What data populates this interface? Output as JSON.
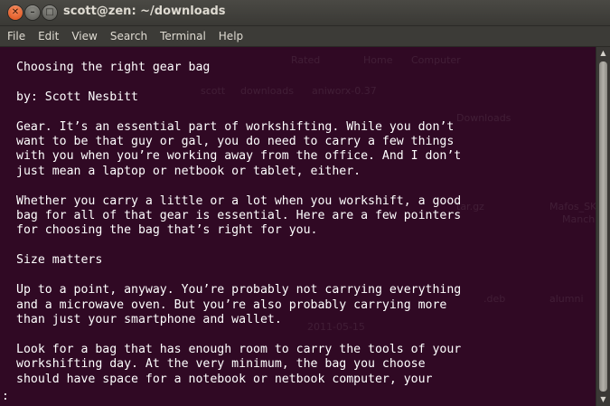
{
  "window": {
    "title": "scott@zen: ~/downloads",
    "controls": {
      "close_glyph": "✕",
      "minimize_glyph": "–",
      "maximize_glyph": "□"
    }
  },
  "menubar": {
    "items": [
      "File",
      "Edit",
      "View",
      "Search",
      "Terminal",
      "Help"
    ]
  },
  "terminal": {
    "lines": [
      "Choosing the right gear bag",
      "",
      "by: Scott Nesbitt",
      "",
      "Gear. It’s an essential part of workshifting. While you don’t",
      "want to be that guy or gal, you do need to carry a few things",
      "with you when you’re working away from the office. And I don’t",
      "just mean a laptop or netbook or tablet, either.",
      "",
      "Whether you carry a little or a lot when you workshift, a good",
      "bag for all of that gear is essential. Here are a few pointers",
      "for choosing the bag that’s right for you.",
      "",
      "Size matters",
      "",
      "Up to a point, anyway. You’re probably not carrying everything",
      "and a microwave oven. But you’re also probably carrying more",
      "than just your smartphone and wallet.",
      "",
      "Look for a bag that has enough room to carry the tools of your",
      "workshifting day. At the very minimum, the bag you choose",
      "should have space for a notebook or netbook computer, your"
    ],
    "prompt": ":"
  },
  "ghost": {
    "labels": [
      "Rated",
      "Home",
      "Computer",
      "scott",
      "downloads",
      "aniworx-0.37",
      "Downloads",
      "2011-05-15",
      ".deb",
      "alumni",
      "5-1-4-16.fs",
      "tar.gz",
      "Mafos_SK",
      "Manch"
    ]
  },
  "colors": {
    "terminal_bg": "#300a24",
    "text": "#ffffff",
    "titlebar": "#3c3b37",
    "close_button": "#e0571f"
  }
}
